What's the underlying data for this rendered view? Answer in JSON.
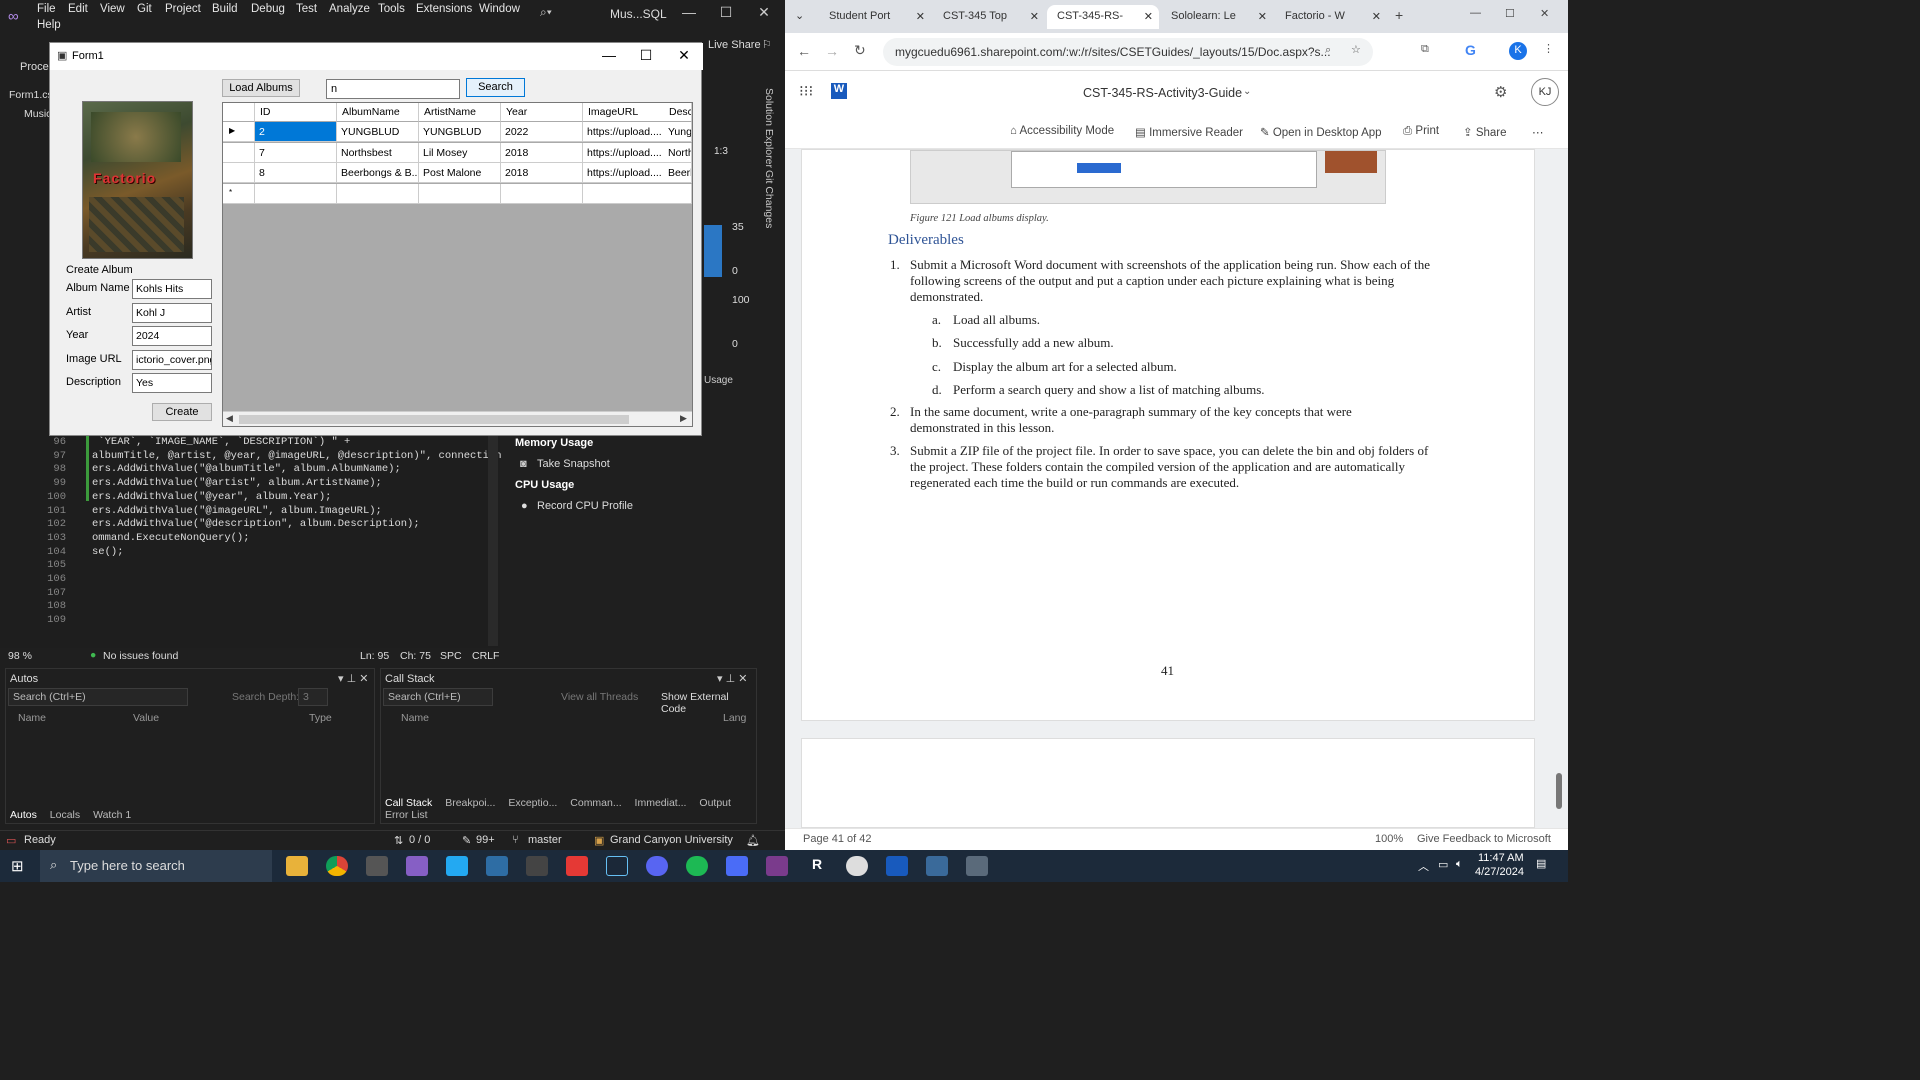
{
  "vs": {
    "menus": [
      "File",
      "Edit",
      "View",
      "Git",
      "Project",
      "Build",
      "Debug",
      "Test",
      "Analyze",
      "Tools",
      "Extensions",
      "Window",
      "Help"
    ],
    "title": "Mus...SQL",
    "live_share": "Live Share",
    "process_label": "Proces",
    "tab_label": "Form1.cs",
    "music_label": "Music",
    "side_panels": [
      "Solution Explorer",
      "Git Changes"
    ],
    "code_lines": [
      {
        "n": "96",
        "t": " `YEAR`, `IMAGE_NAME`, `DESCRIPTION`) \" +"
      },
      {
        "n": "97",
        "t": "albumTitle, @artist, @year, @imageURL, @description)\", connection"
      },
      {
        "n": "98",
        "t": "ers.AddWithValue(\"@albumTitle\", album.AlbumName);"
      },
      {
        "n": "99",
        "t": "ers.AddWithValue(\"@artist\", album.ArtistName);"
      },
      {
        "n": "100",
        "t": "ers.AddWithValue(\"@year\", album.Year);"
      },
      {
        "n": "101",
        "t": "ers.AddWithValue(\"@imageURL\", album.ImageURL);"
      },
      {
        "n": "102",
        "t": "ers.AddWithValue(\"@description\", album.Description);"
      },
      {
        "n": "103",
        "t": "ommand.ExecuteNonQuery();"
      },
      {
        "n": "104",
        "t": "se();"
      },
      {
        "n": "105",
        "t": ""
      },
      {
        "n": "106",
        "t": ""
      },
      {
        "n": "107",
        "t": ""
      },
      {
        "n": "108",
        "t": ""
      },
      {
        "n": "109",
        "t": ""
      }
    ],
    "editor_status": {
      "zoom": "98 %",
      "issues": "No issues found",
      "ln": "Ln: 95",
      "ch": "Ch: 75",
      "spc": "SPC",
      "crlf": "CRLF"
    },
    "diag": {
      "memory": "Memory Usage",
      "snapshot": "Take Snapshot",
      "cpu": "CPU Usage",
      "record": "Record CPU Profile",
      "v35": "35",
      "v0a": "0",
      "v100": "100",
      "v0b": "0",
      "time": "1:3",
      "usage": "Usage"
    },
    "autos": {
      "title": "Autos",
      "search": "Search (Ctrl+E)",
      "depth_label": "Search Depth:",
      "depth": "3",
      "cols": [
        "Name",
        "Value",
        "Type"
      ],
      "tabs": [
        "Autos",
        "Locals",
        "Watch 1"
      ]
    },
    "callstack": {
      "title": "Call Stack",
      "search": "Search (Ctrl+E)",
      "view_threads": "View all Threads",
      "external": "Show External Code",
      "cols": [
        "Name",
        "Lang"
      ],
      "tabs": [
        "Call Stack",
        "Breakpoi...",
        "Exceptio...",
        "Comman...",
        "Immediat...",
        "Output",
        "Error List"
      ]
    },
    "status": {
      "ready": "Ready",
      "arrows": "0 / 0",
      "pencil": "99+",
      "branch": "master",
      "org": "Grand Canyon University"
    }
  },
  "form1": {
    "title": "Form1",
    "load_btn": "Load Albums",
    "search_value": "n",
    "search_btn": "Search",
    "create_label": "Create Album",
    "fields": [
      {
        "label": "Album Name",
        "value": "Kohls Hits"
      },
      {
        "label": "Artist",
        "value": "Kohl J"
      },
      {
        "label": "Year",
        "value": "2024"
      },
      {
        "label": "Image URL",
        "value": "ictorio_cover.png"
      },
      {
        "label": "Description",
        "value": "Yes"
      }
    ],
    "create_btn": "Create",
    "art_text": "Factorio",
    "grid": {
      "headers": [
        "ID",
        "AlbumName",
        "ArtistName",
        "Year",
        "ImageURL",
        "Desc"
      ],
      "rows": [
        [
          "2",
          "YUNGBLUD",
          "YUNGBLUD",
          "2022",
          "https://upload....",
          "Yungb"
        ],
        [
          "7",
          "Northsbest",
          "Lil Mosey",
          "2018",
          "https://upload....",
          "North"
        ],
        [
          "8",
          "Beerbongs & B...",
          "Post Malone",
          "2018",
          "https://upload....",
          "Beerb"
        ]
      ]
    }
  },
  "chrome": {
    "tabs": [
      "Student Port",
      "CST-345 Top",
      "CST-345-RS-",
      "Sololearn: Le",
      "Factorio - W"
    ],
    "url": "mygcuedu6961.sharepoint.com/:w:/r/sites/CSETGuides/_layouts/15/Doc.aspx?s...",
    "profile": "K",
    "doc_title": "CST-345-RS-Activity3-Guide",
    "user": "KJ",
    "commands": [
      "Accessibility Mode",
      "Immersive Reader",
      "Open in Desktop App",
      "Print",
      "Share"
    ],
    "caption": "Figure 121 Load albums display.",
    "heading": "Deliverables",
    "item1": "Submit a Microsoft Word document with screenshots of the application being run. Show each of the following screens of the output and put a caption under each picture explaining what is being demonstrated.",
    "subitems": [
      {
        "k": "a.",
        "t": "Load all albums."
      },
      {
        "k": "b.",
        "t": "Successfully add a new album."
      },
      {
        "k": "c.",
        "t": "Display the album art for a selected album."
      },
      {
        "k": "d.",
        "t": "Perform a search query and show a list of matching albums."
      }
    ],
    "item2": "In the same document, write a one-paragraph summary of the key concepts that were demonstrated in this lesson.",
    "item3": "Submit a ZIP file of the project file. In order to save space, you can delete the bin and obj folders of the project. These folders contain the compiled version of the application and are automatically regenerated each time the build or run commands are executed.",
    "page_num": "41",
    "page_status": "Page 41 of 42",
    "zoom": "100%",
    "feedback": "Give Feedback to Microsoft"
  },
  "taskbar": {
    "search": "Type here to search",
    "time": "11:47 AM",
    "date": "4/27/2024"
  }
}
